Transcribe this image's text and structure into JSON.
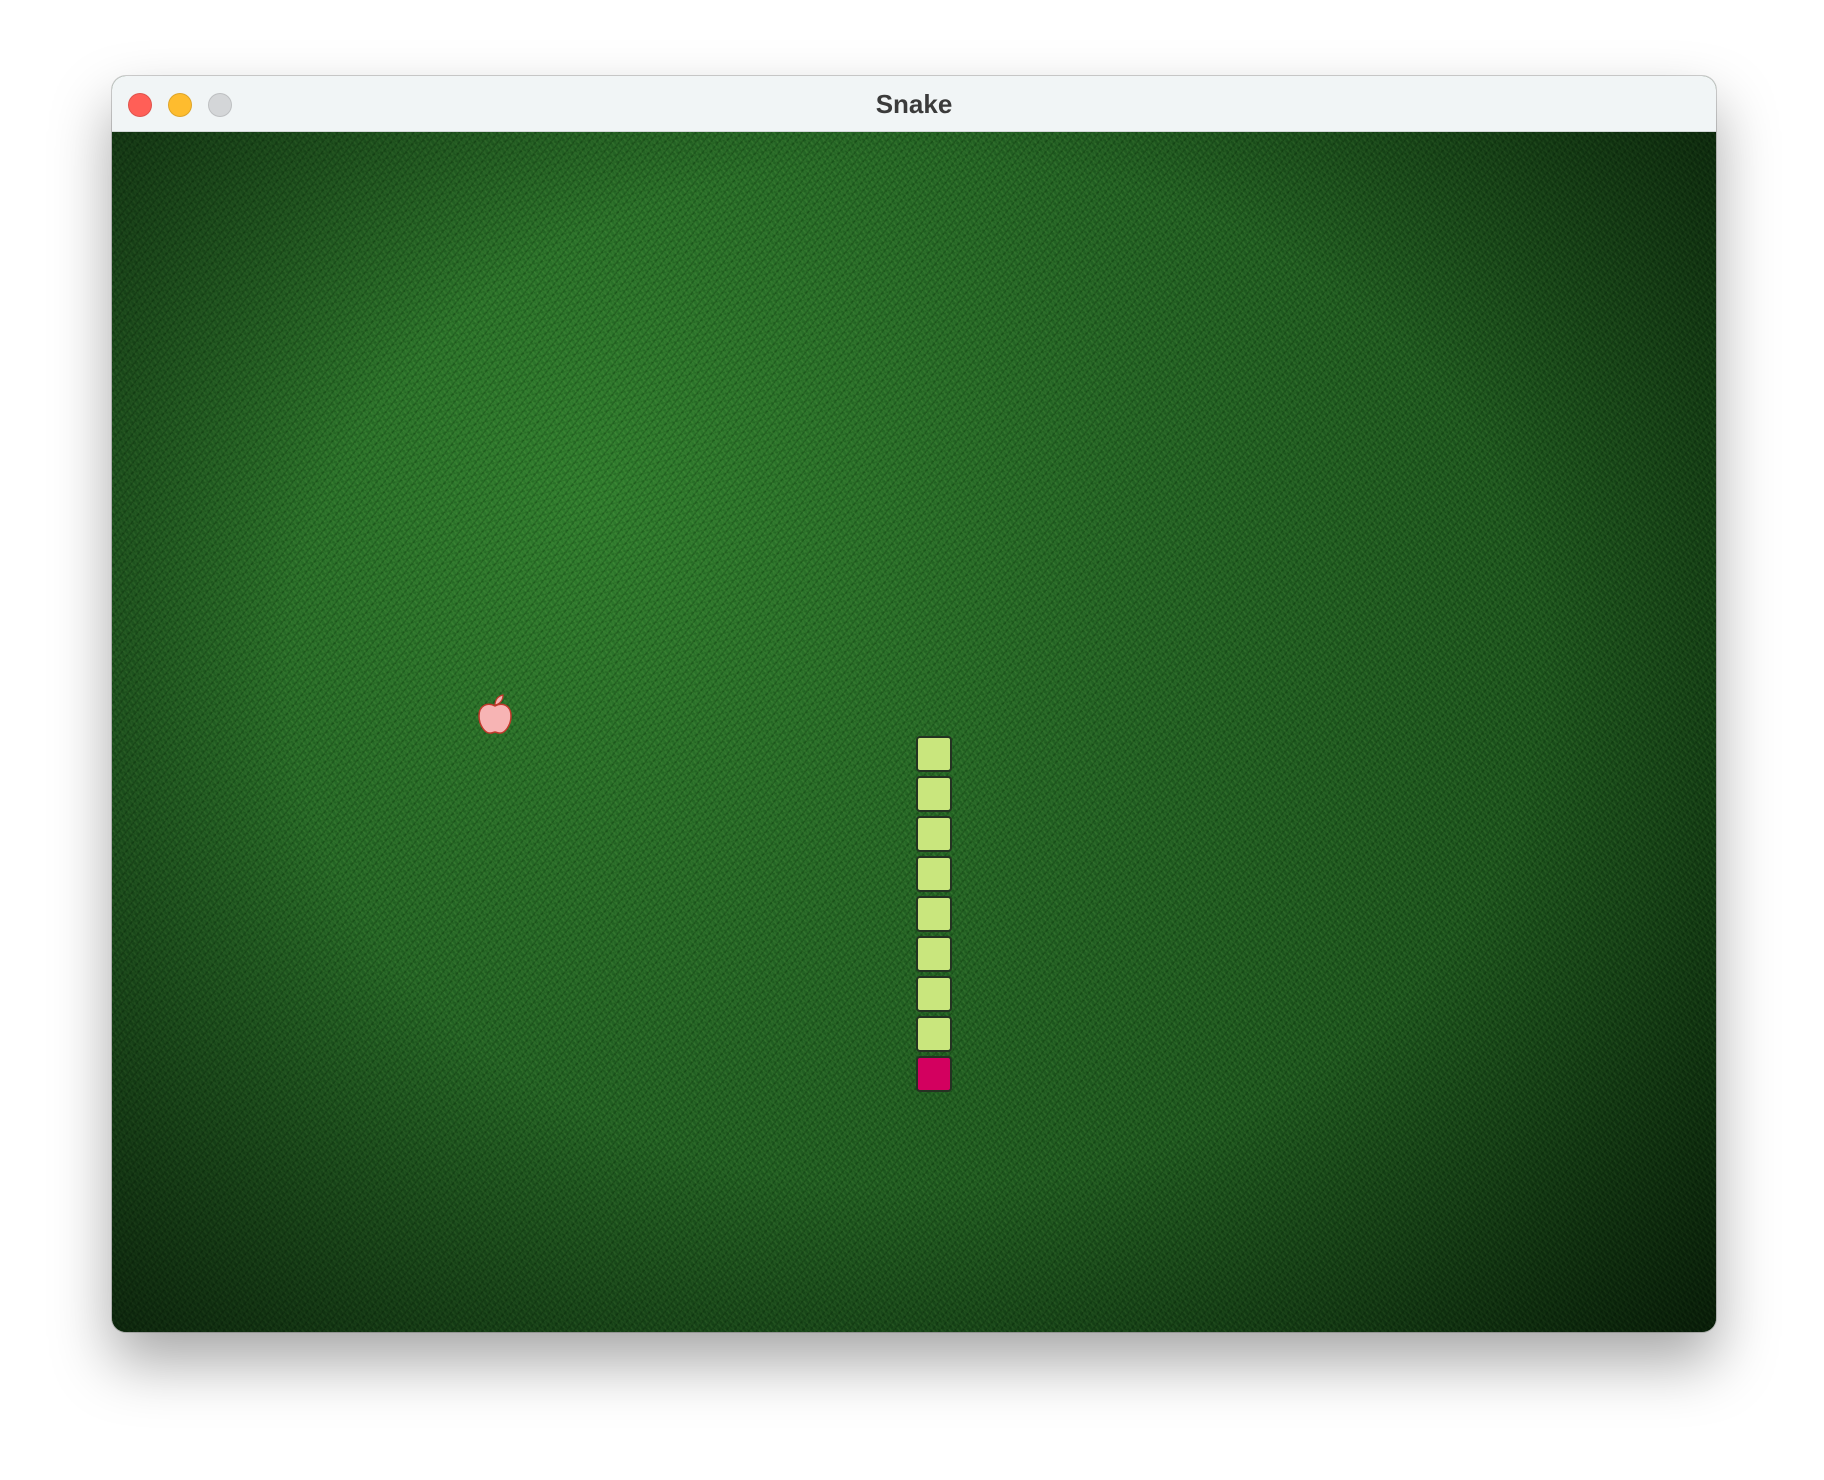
{
  "window": {
    "title": "Snake"
  },
  "colors": {
    "close": "#ff5f57",
    "minimize": "#febc2e",
    "zoom": "#d4d6d8",
    "snake_body": "#c9e67d",
    "snake_head": "#d3005f",
    "apple": "#f7b4b4",
    "apple_outline": "#c0392b"
  },
  "icons": {
    "food": "apple-icon"
  },
  "game": {
    "grid": {
      "cols": 40,
      "rows": 30
    },
    "apple": {
      "col": 9,
      "row": 14
    },
    "snake_head_index": 8,
    "snake": [
      {
        "col": 20,
        "row": 15
      },
      {
        "col": 20,
        "row": 16
      },
      {
        "col": 20,
        "row": 17
      },
      {
        "col": 20,
        "row": 18
      },
      {
        "col": 20,
        "row": 19
      },
      {
        "col": 20,
        "row": 20
      },
      {
        "col": 20,
        "row": 21
      },
      {
        "col": 20,
        "row": 22
      },
      {
        "col": 20,
        "row": 23
      }
    ]
  }
}
